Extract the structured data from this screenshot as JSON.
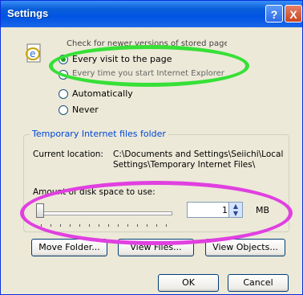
{
  "window": {
    "title": "Settings",
    "help_glyph": "?",
    "close_glyph": "X"
  },
  "check": {
    "heading_partial": "Check for newer versions of stored pages:",
    "options": [
      {
        "label": "Every visit to the page",
        "selected": true
      },
      {
        "label": "Every time you start Internet Explorer",
        "selected": false
      },
      {
        "label": "Automatically",
        "selected": false
      },
      {
        "label": "Never",
        "selected": false
      }
    ]
  },
  "temp_folder": {
    "group_label": "Temporary Internet files folder",
    "current_location_label": "Current location:",
    "path": "C:\\Documents and Settings\\Seiichi\\Local Settings\\Temporary Internet Files\\",
    "disk_space_label": "Amount of disk space to use:",
    "disk_value": "1",
    "unit": "MB",
    "slider_fraction": 0
  },
  "buttons": {
    "move_folder": "Move Folder...",
    "view_files": "View Files...",
    "view_objects": "View Objects...",
    "ok": "OK",
    "cancel": "Cancel"
  },
  "colors": {
    "title_bar": "#0054e3",
    "window_bg": "#ece9d8",
    "group_label": "#0046d5",
    "highlight_green": "#37e037",
    "highlight_magenta": "#e040e0"
  }
}
